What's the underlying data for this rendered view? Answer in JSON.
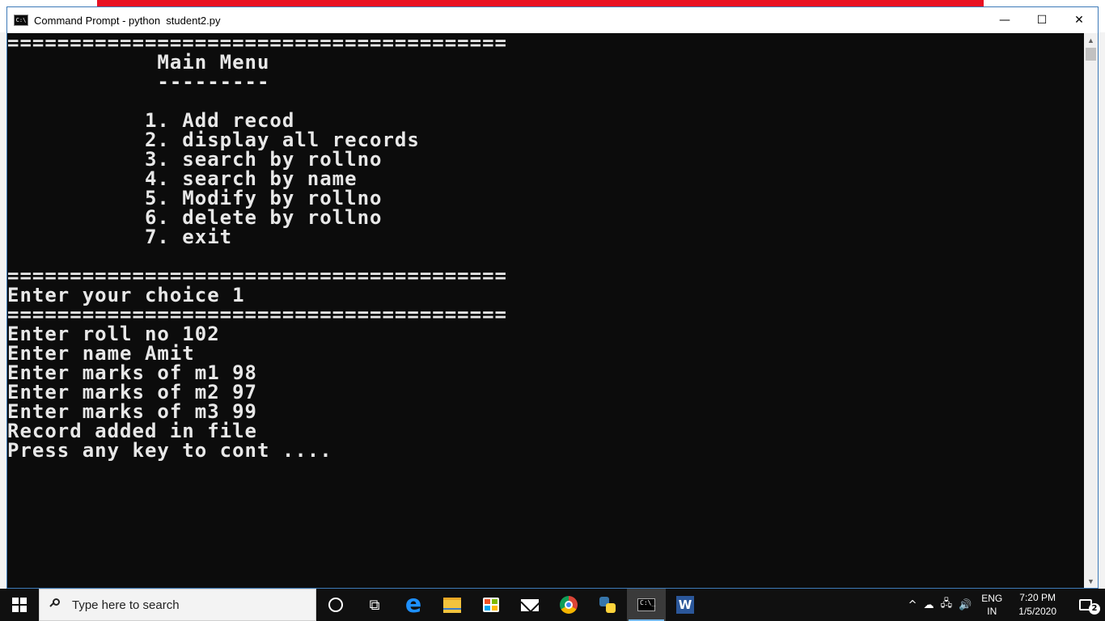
{
  "window": {
    "title": "Command Prompt - python  student2.py",
    "minimize": "—",
    "maximize": "☐",
    "close": "✕"
  },
  "console": {
    "lines": [
      "========================================",
      "            Main Menu",
      "            ---------",
      "",
      "           1. Add recod",
      "           2. display all records",
      "           3. search by rollno",
      "           4. search by name",
      "           5. Modify by rollno",
      "           6. delete by rollno",
      "           7. exit",
      "",
      "========================================",
      "Enter your choice 1",
      "========================================",
      "Enter roll no 102",
      "Enter name Amit",
      "Enter marks of m1 98",
      "Enter marks of m2 97",
      "Enter marks of m3 99",
      "Record added in file",
      "Press any key to cont ...."
    ]
  },
  "taskbar": {
    "search_placeholder": "Type here to search",
    "apps": [
      "cortana-icon",
      "task-view-icon",
      "edge-icon",
      "file-explorer-icon",
      "store-icon",
      "mail-icon",
      "chrome-icon",
      "python-icon",
      "command-prompt-icon",
      "word-icon"
    ],
    "tray": {
      "chevron": "^",
      "lang_top": "ENG",
      "lang_bottom": "IN",
      "time": "7:20 PM",
      "date": "1/5/2020",
      "notification_count": "2"
    }
  },
  "colors": {
    "console_bg": "#0c0c0c",
    "console_text": "#e8e8e8",
    "taskbar_bg": "#101010"
  }
}
